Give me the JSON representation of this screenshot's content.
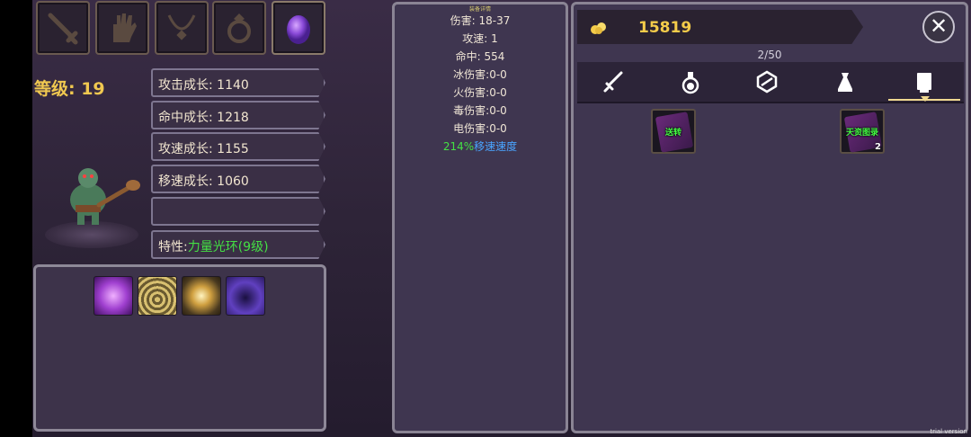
{
  "level_label": "等级: 19",
  "equipment_slots": [
    {
      "icon": "sword-icon"
    },
    {
      "icon": "glove-icon"
    },
    {
      "icon": "necklace-icon"
    },
    {
      "icon": "ring-icon"
    },
    {
      "icon": "pet-egg-icon"
    }
  ],
  "stats": {
    "attack_growth": "攻击成长: 1140",
    "hit_growth": "命中成长: 1218",
    "speed_growth": "攻速成长: 1155",
    "move_growth": "移速成长: 1060",
    "empty": "",
    "trait_label": "特性:",
    "trait_value": "力量光环(9级)"
  },
  "skills": [
    {
      "icon": "purple-warrior-skill-icon"
    },
    {
      "icon": "golden-shockwave-skill-icon"
    },
    {
      "icon": "golden-orb-skill-icon"
    },
    {
      "icon": "purple-spirit-skill-icon"
    }
  ],
  "details": {
    "header": "装备详情",
    "damage": "伤害: 18-37",
    "attack_speed": "攻速: 1",
    "accuracy": "命中: 554",
    "ice_damage": "冰伤害:0-0",
    "fire_damage": "火伤害:0-0",
    "poison_damage": "毒伤害:0-0",
    "electric_damage": "电伤害:0-0",
    "move_speed_value": "214%",
    "move_speed_label": "移速速度"
  },
  "inventory": {
    "gold": "15819",
    "capacity": "2/50",
    "close_label": "✕",
    "tabs": [
      {
        "icon": "sword-tab-icon"
      },
      {
        "icon": "potion-tab-icon"
      },
      {
        "icon": "gem-tab-icon"
      },
      {
        "icon": "bag-tab-icon"
      },
      {
        "icon": "book-tab-icon",
        "active": true
      }
    ],
    "items": [
      {
        "label": "送转",
        "count": ""
      },
      {
        "label": "天资图录",
        "count": "2"
      }
    ]
  },
  "watermark": "trial version",
  "colors": {
    "gold": "#f4cc4a",
    "green": "#44e044",
    "blue": "#4aa4ff",
    "level": "#f0c850"
  }
}
